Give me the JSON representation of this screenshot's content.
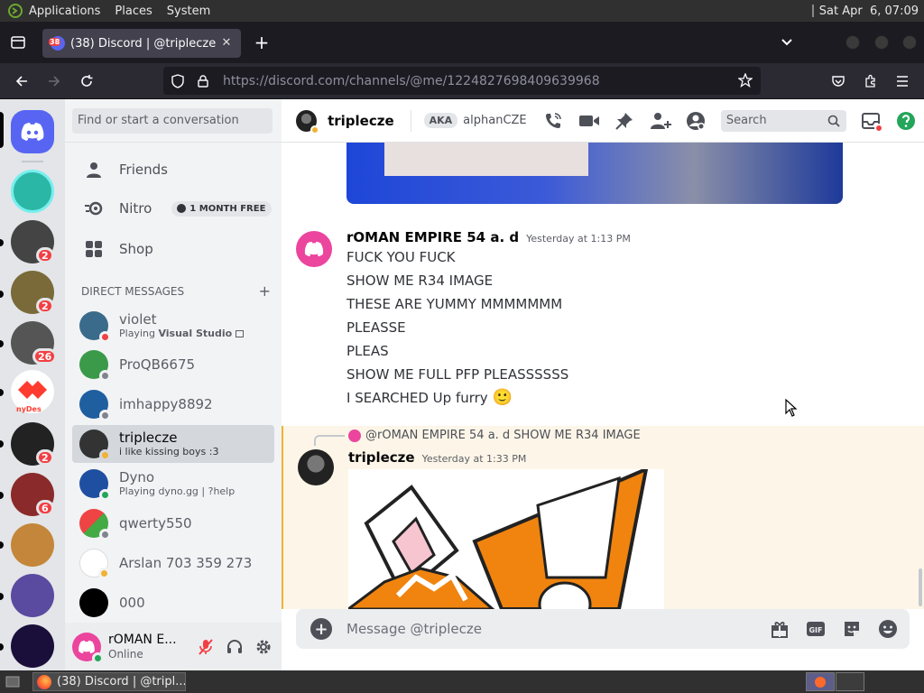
{
  "system_bar": {
    "menus": [
      "Applications",
      "Places",
      "System"
    ],
    "clock": "Sat Apr  6, 07:09"
  },
  "browser": {
    "tab_title": "(38) Discord | @triplecze",
    "tab_badge": "38",
    "url_host": "https://discord.com",
    "url_path": "/channels/@me/1224827698409639968"
  },
  "servers": [
    {
      "name": "Discord home",
      "color": "#5865f2"
    },
    {
      "name": "server-1",
      "color": "#2bb7a5"
    },
    {
      "name": "server-2",
      "color": "#444444",
      "badge": "2"
    },
    {
      "name": "server-3",
      "color": "#7a6a3a",
      "badge": "2"
    },
    {
      "name": "server-4",
      "color": "#555555",
      "badge": "26"
    },
    {
      "name": "server-5",
      "color": "#ff3c2f",
      "text": "nyDes"
    },
    {
      "name": "server-6",
      "color": "#222222",
      "badge": "2"
    },
    {
      "name": "server-7",
      "color": "#8a2a2a",
      "badge": "6"
    },
    {
      "name": "server-8",
      "color": "#c4863a"
    },
    {
      "name": "server-9",
      "color": "#5a4aa0"
    },
    {
      "name": "server-10",
      "color": "#1a0f3a"
    }
  ],
  "sidebar": {
    "search_placeholder": "Find or start a conversation",
    "nav": {
      "friends": "Friends",
      "nitro": "Nitro",
      "nitro_badge": "1 MONTH FREE",
      "shop": "Shop"
    },
    "dm_header": "DIRECT MESSAGES",
    "dms": [
      {
        "name": "violet",
        "activity_prefix": "Playing ",
        "activity_bold": "Visual Studio",
        "color": "#3a6b8a",
        "status": "#f23f43"
      },
      {
        "name": "ProQB6675",
        "activity_prefix": "",
        "activity_bold": "",
        "color": "#3a9a4a",
        "status": "#80848e"
      },
      {
        "name": "imhappy8892",
        "activity_prefix": "",
        "activity_bold": "",
        "color": "#1f5fa0",
        "status": "#80848e"
      },
      {
        "name": "triplecze",
        "activity_prefix": "i like kissing boys :3",
        "activity_bold": "",
        "color": "#333333",
        "status": "#f0b232"
      },
      {
        "name": "Dyno",
        "activity_prefix": "Playing dyno.gg | ?help",
        "activity_bold": "",
        "color": "#1f4fa0",
        "status": "#23a55a"
      },
      {
        "name": "qwerty550",
        "activity_prefix": "",
        "activity_bold": "",
        "color": "#4aa04a",
        "status": "#80848e"
      },
      {
        "name": "Arslan 703 359 273",
        "activity_prefix": "",
        "activity_bold": "",
        "color": "#ffffff",
        "status": "#f0b232"
      },
      {
        "name": "000",
        "activity_prefix": "",
        "activity_bold": "",
        "color": "#000000",
        "status": "#80848e"
      }
    ],
    "user": {
      "name": "rOMAN E...",
      "status": "Online"
    }
  },
  "chat": {
    "recipient": "triplecze",
    "aka_label": "AKA",
    "aka_name": "alphanCZE",
    "search_placeholder": "Search",
    "message1": {
      "author": "rOMAN EMPIRE 54 a. d",
      "time": "Yesterday at 1:13 PM",
      "lines": [
        "FUCK YOU FUCK",
        "SHOW ME R34 IMAGE",
        "THESE ARE YUMMY MMMMMMM",
        "PLEASSE",
        "PLEAS",
        "SHOW ME FULL PFP PLEASSSSSS",
        "I SEARCHED Up furry"
      ],
      "emoji": "🙂"
    },
    "message2": {
      "reply_author": "@rOMAN EMPIRE 54 a. d",
      "reply_text": "SHOW ME R34 IMAGE",
      "author": "triplecze",
      "time": "Yesterday at 1:33 PM"
    },
    "composer_placeholder": "Message @triplecze"
  },
  "taskbar": {
    "window_title": "(38) Discord | @tripl..."
  },
  "colors": {
    "blurple": "#5865f2",
    "mention_bg": "#fdf6e8",
    "mention_bar": "#f0b232"
  }
}
